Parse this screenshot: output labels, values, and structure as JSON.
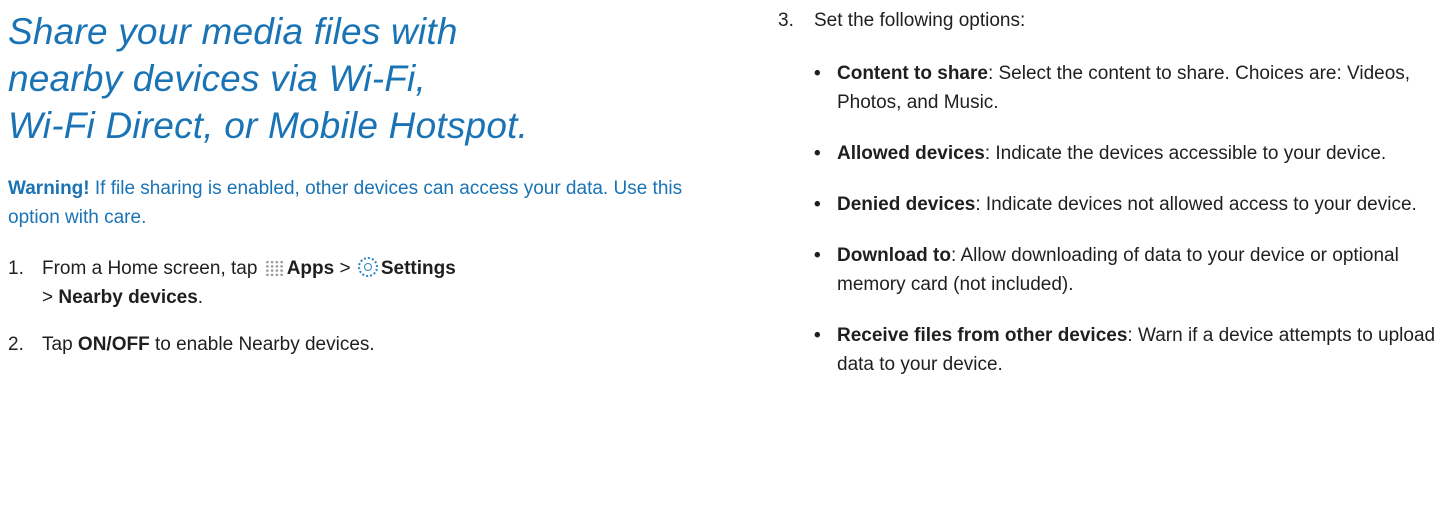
{
  "intro": {
    "title_lines": [
      "Share your media files with",
      "nearby devices via Wi-Fi,",
      "Wi-Fi Direct, or Mobile Hotspot."
    ]
  },
  "warning": {
    "label": "Warning!",
    "text": " If file sharing is enabled, other devices can access your data. Use this option with care."
  },
  "steps": [
    {
      "number": "1.",
      "prefix": "From a Home screen, tap ",
      "apps_icon": "apps-grid-icon",
      "apps_label": "Apps",
      "sep1": " > ",
      "settings_icon": "settings-gear-icon",
      "settings_label": "Settings",
      "sep2": " > ",
      "nearby_label": "Nearby devices",
      "suffix": "."
    },
    {
      "number": "2.",
      "prefix": "Tap ",
      "bold": "ON/OFF",
      "suffix": " to enable Nearby devices."
    },
    {
      "number": "3.",
      "text": "Set the following options:",
      "options": [
        {
          "label": "Content to share",
          "text": ": Select the content to share. Choices are: Videos, Photos, and Music."
        },
        {
          "label": "Allowed devices",
          "text": ": Indicate the devices accessible to your device."
        },
        {
          "label": "Denied devices",
          "text": ": Indicate devices not allowed access to your device."
        },
        {
          "label": "Download to",
          "text": ": Allow downloading of data to your device or optional memory card (not included)."
        },
        {
          "label": "Receive files from other devices",
          "text": ": Warn if a device attempts to upload data to your device."
        }
      ]
    }
  ],
  "colors": {
    "accent": "#1a73b4",
    "body_text": "#1f1f1f"
  }
}
